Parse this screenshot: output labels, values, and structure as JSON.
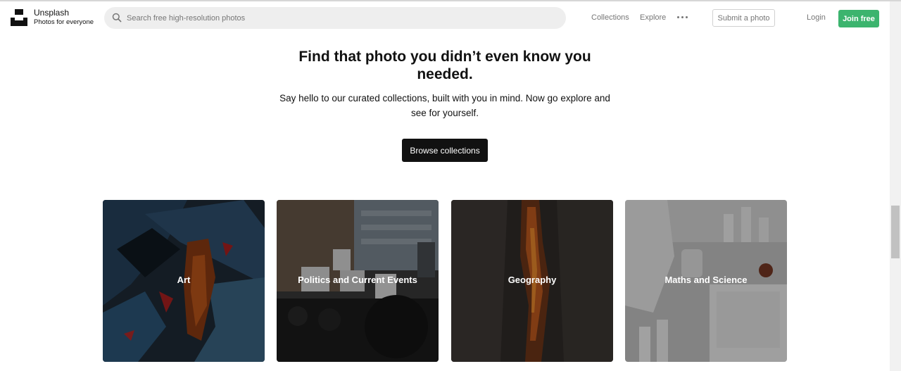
{
  "header": {
    "brand_name": "Unsplash",
    "brand_tagline": "Photos for everyone",
    "search_placeholder": "Search free high-resolution photos",
    "nav_collections": "Collections",
    "nav_explore": "Explore",
    "submit_label": "Submit a photo",
    "login_label": "Login",
    "join_label": "Join free"
  },
  "hero": {
    "title": "Find that photo you didn’t even know you needed.",
    "subtitle": "Say hello to our curated collections, built with you in mind. Now go explore and see for yourself.",
    "button_label": "Browse collections"
  },
  "collections": [
    {
      "label": "Art"
    },
    {
      "label": "Politics and Current Events"
    },
    {
      "label": "Geography"
    },
    {
      "label": "Maths and Science"
    }
  ],
  "colors": {
    "accent_green": "#3cb46e",
    "primary_dark": "#111111",
    "muted_text": "#767676",
    "search_bg": "#eeeeee"
  }
}
